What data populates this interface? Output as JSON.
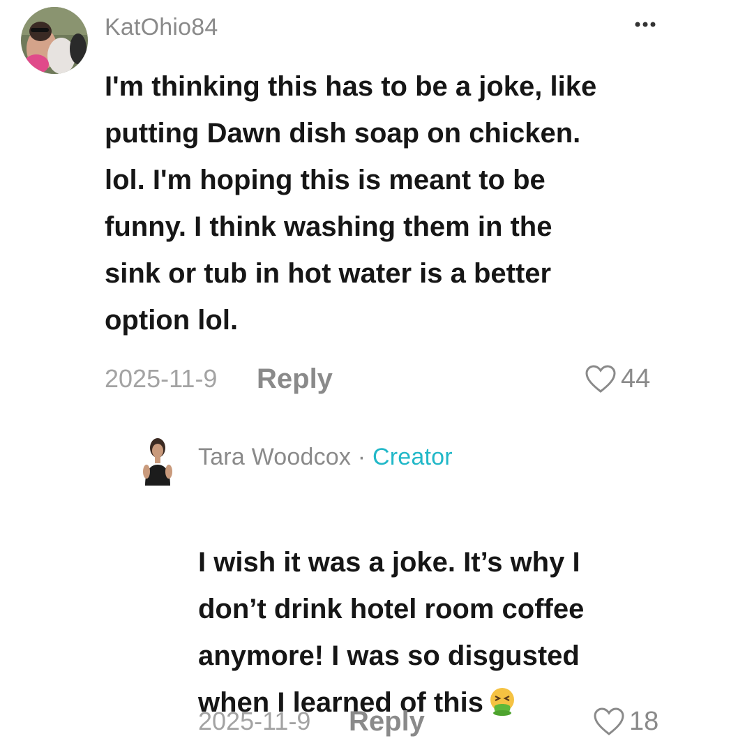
{
  "comments": [
    {
      "username": "KatOhio84",
      "text": "I'm thinking this has to be a joke, like\nputting Dawn dish soap on chicken.\nlol. I'm hoping this is meant to be\nfunny. I think washing them in the\nsink or tub in hot water is a better\noption lol.",
      "date": "2025-11-9",
      "reply_label": "Reply",
      "likes": "44",
      "more_icon": "more-options-icon"
    }
  ],
  "replies": [
    {
      "username": "Tara Woodcox",
      "separator": "·",
      "badge": "Creator",
      "text": "I wish it was a joke. It’s why I\ndon’t drink hotel room coffee\nanymore! I was so disgusted\nwhen I learned of this",
      "emoji": "nauseated-face-emoji",
      "date": "2025-11-9",
      "reply_label": "Reply",
      "likes": "18"
    }
  ],
  "colors": {
    "username": "#8a8a8a",
    "creator_badge": "#22b8c8",
    "body_text": "#161616",
    "meta": "#a3a3a3"
  }
}
